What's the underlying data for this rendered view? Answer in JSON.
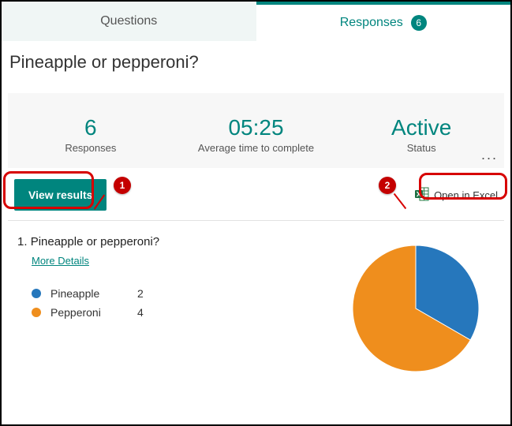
{
  "tabs": {
    "questions": "Questions",
    "responses": "Responses",
    "badge": "6"
  },
  "title": "Pineapple or pepperoni?",
  "summary": {
    "responses": {
      "value": "6",
      "label": "Responses"
    },
    "avg_time": {
      "value": "05:25",
      "label": "Average time to complete"
    },
    "status": {
      "value": "Active",
      "label": "Status"
    }
  },
  "actions": {
    "view_results": "View results",
    "open_excel": "Open in Excel",
    "more": "..."
  },
  "annotations": {
    "one": "1",
    "two": "2"
  },
  "question": {
    "number": "1.",
    "text": "Pineapple or pepperoni?",
    "more_details": "More Details"
  },
  "chart_data": {
    "type": "pie",
    "title": "Pineapple or pepperoni?",
    "categories": [
      "Pineapple",
      "Pepperoni"
    ],
    "values": [
      2,
      4
    ],
    "colors": [
      "#2677bc",
      "#ef8e1d"
    ]
  }
}
